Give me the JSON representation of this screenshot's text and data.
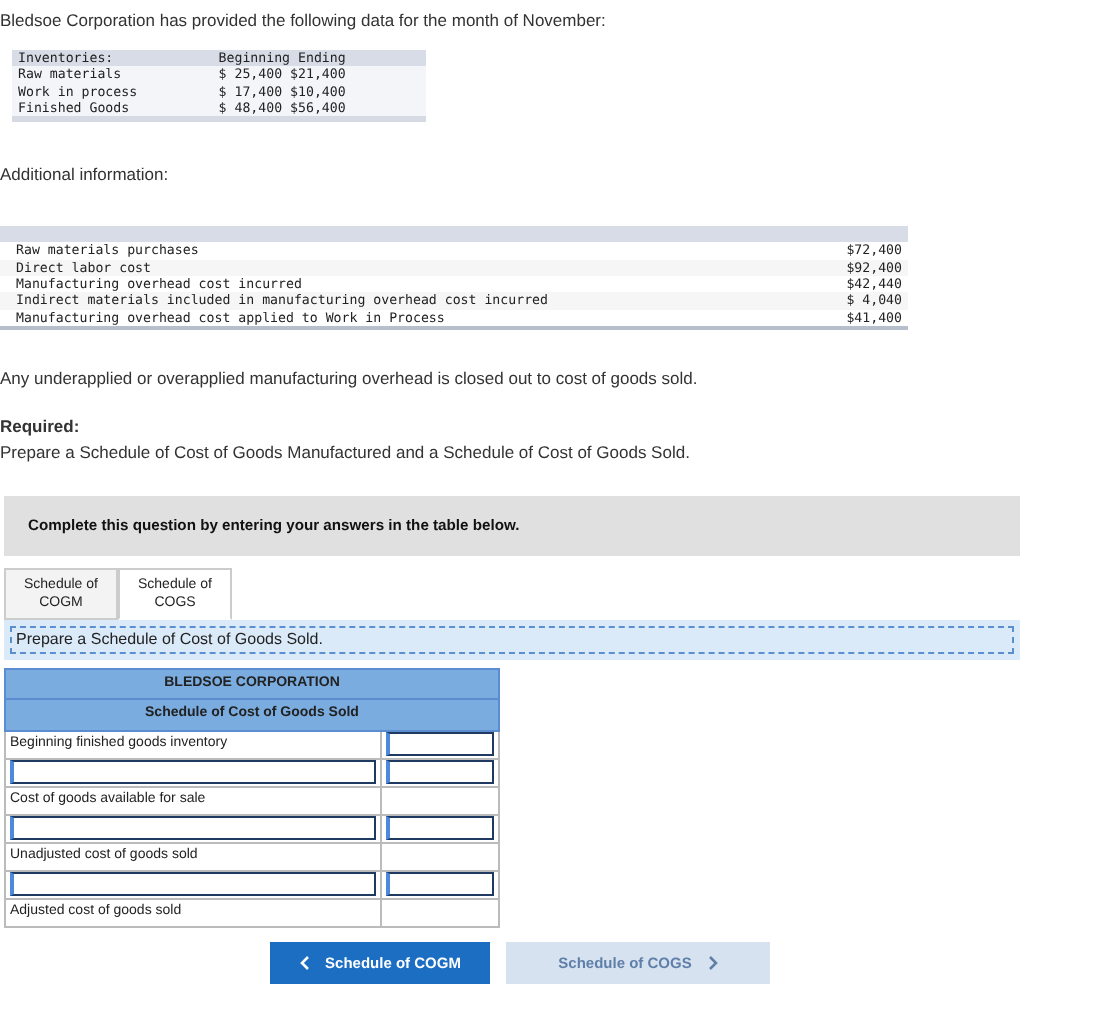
{
  "intro": "Bledsoe Corporation has provided the following data for the month of November:",
  "inventories": {
    "heading": "Inventories:",
    "columns": [
      "Beginning",
      "Ending"
    ],
    "rows": [
      {
        "label": "Raw materials",
        "values": [
          "$ 25,400",
          "$21,400"
        ]
      },
      {
        "label": "Work in process",
        "values": [
          "$ 17,400",
          "$10,400"
        ]
      },
      {
        "label": "Finished Goods",
        "values": [
          "$ 48,400",
          "$56,400"
        ]
      }
    ]
  },
  "additional_heading": "Additional information:",
  "additional": [
    {
      "label": "Raw materials purchases",
      "value": "$72,400"
    },
    {
      "label": "Direct labor cost",
      "value": "$92,400"
    },
    {
      "label": "Manufacturing overhead cost incurred",
      "value": "$42,440"
    },
    {
      "label": "Indirect materials included in manufacturing overhead cost incurred",
      "value": "$ 4,040"
    },
    {
      "label": "Manufacturing overhead cost applied to Work in Process",
      "value": "$41,400"
    }
  ],
  "note": "Any underapplied or overapplied manufacturing overhead is closed out to cost of goods sold.",
  "required_label": "Required:",
  "required_text": "Prepare a Schedule of Cost of Goods Manufactured and a Schedule of Cost of Goods Sold.",
  "instruction_box": "Complete this question by entering your answers in the table below.",
  "tabs": [
    {
      "label": "Schedule of COGM",
      "selected": false
    },
    {
      "label": "Schedule of COGS",
      "selected": true
    }
  ],
  "task": "Prepare a Schedule of Cost of Goods Sold.",
  "schedule": {
    "title": "BLEDSOE CORPORATION",
    "subtitle": "Schedule of Cost of Goods Sold",
    "rows": [
      {
        "kind": "given",
        "label": "Beginning finished goods inventory"
      },
      {
        "kind": "input"
      },
      {
        "kind": "total",
        "label": "Cost of goods available for sale"
      },
      {
        "kind": "input"
      },
      {
        "kind": "total",
        "label": "Unadjusted cost of goods sold"
      },
      {
        "kind": "input"
      },
      {
        "kind": "total",
        "label": "Adjusted cost of goods sold"
      }
    ]
  },
  "buttons": [
    {
      "kind": "prev",
      "label": "Schedule of COGM",
      "disabled": false
    },
    {
      "kind": "next",
      "label": "Schedule of COGS",
      "disabled": true
    }
  ]
}
